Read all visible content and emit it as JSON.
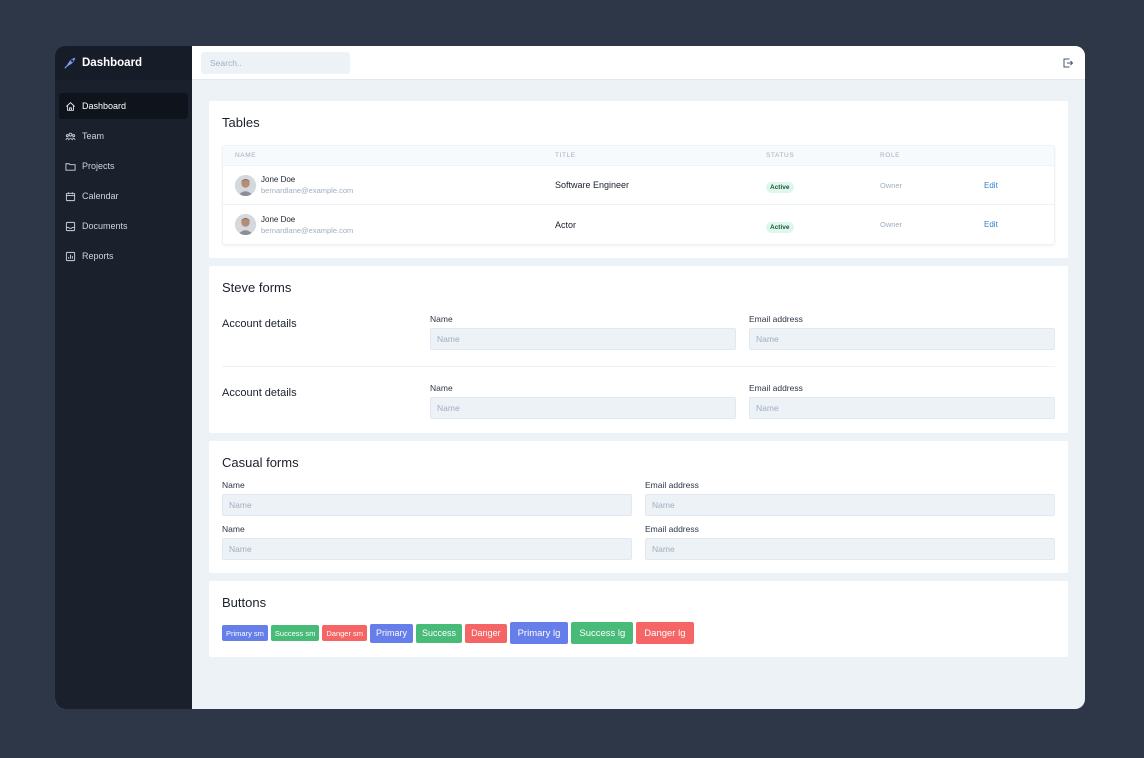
{
  "sidebar": {
    "brand_title": "Dashboard",
    "items": [
      {
        "label": "Dashboard",
        "icon": "home-icon",
        "active": true
      },
      {
        "label": "Team",
        "icon": "team-icon"
      },
      {
        "label": "Projects",
        "icon": "folder-icon"
      },
      {
        "label": "Calendar",
        "icon": "calendar-icon"
      },
      {
        "label": "Documents",
        "icon": "inbox-icon"
      },
      {
        "label": "Reports",
        "icon": "chart-icon"
      }
    ]
  },
  "topbar": {
    "search_placeholder": "Search..",
    "logout_icon": "logout-icon"
  },
  "tables": {
    "title": "Tables",
    "headers": {
      "name": "NAME",
      "title": "TITLE",
      "status": "STATUS",
      "role": "ROLE"
    },
    "rows": [
      {
        "name": "Jone Doe",
        "email": "bernardlane@example.com",
        "title": "Software Engineer",
        "status": "Active",
        "role": "Owner",
        "action": "Edit"
      },
      {
        "name": "Jone Doe",
        "email": "bernardlane@example.com",
        "title": "Actor",
        "status": "Active",
        "role": "Owner",
        "action": "Edit"
      }
    ]
  },
  "steve_forms": {
    "title": "Steve forms",
    "sections": [
      {
        "label": "Account details",
        "name_label": "Name",
        "name_placeholder": "Name",
        "email_label": "Email address",
        "email_placeholder": "Name"
      },
      {
        "label": "Account details",
        "name_label": "Name",
        "name_placeholder": "Name",
        "email_label": "Email address",
        "email_placeholder": "Name"
      }
    ]
  },
  "casual_forms": {
    "title": "Casual forms",
    "rows": [
      {
        "name_label": "Name",
        "name_placeholder": "Name",
        "email_label": "Email address",
        "email_placeholder": "Name"
      },
      {
        "name_label": "Name",
        "name_placeholder": "Name",
        "email_label": "Email address",
        "email_placeholder": "Name"
      }
    ]
  },
  "buttons": {
    "title": "Buttons",
    "items": [
      {
        "label": "Primary sm",
        "variant": "primary",
        "size": "sm"
      },
      {
        "label": "Success sm",
        "variant": "success",
        "size": "sm"
      },
      {
        "label": "Danger sm",
        "variant": "danger",
        "size": "sm"
      },
      {
        "label": "Primary",
        "variant": "primary",
        "size": "md"
      },
      {
        "label": "Success",
        "variant": "success",
        "size": "md"
      },
      {
        "label": "Danger",
        "variant": "danger",
        "size": "md"
      },
      {
        "label": "Primary lg",
        "variant": "primary",
        "size": "lg"
      },
      {
        "label": "Success lg",
        "variant": "success",
        "size": "lg"
      },
      {
        "label": "Danger lg",
        "variant": "danger",
        "size": "lg"
      }
    ]
  },
  "colors": {
    "background": "#2d3748",
    "sidebar": "#1a202c",
    "primary": "#667eea",
    "success": "#48bb78",
    "danger": "#f56565",
    "link": "#3182ce"
  }
}
